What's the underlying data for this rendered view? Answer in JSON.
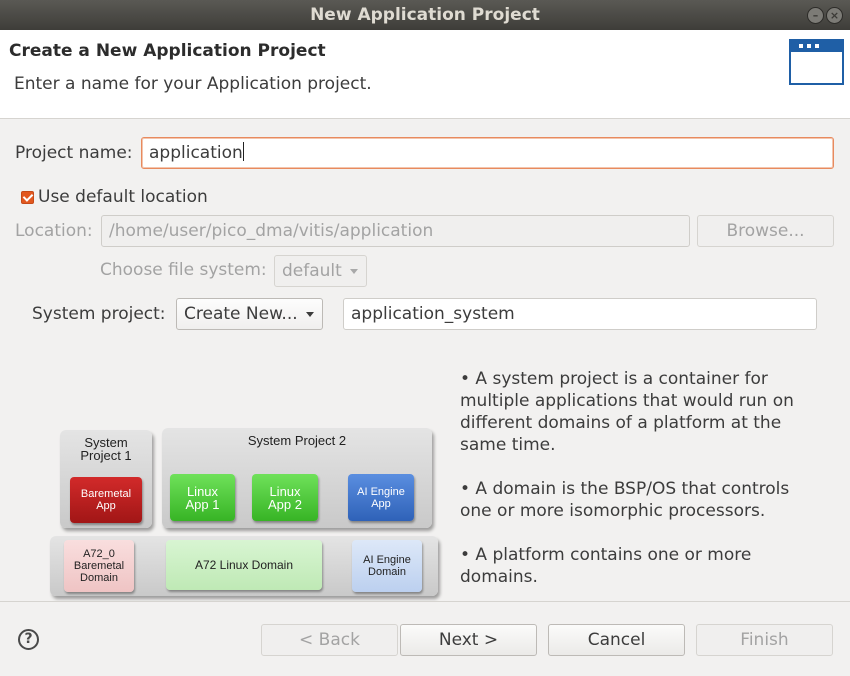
{
  "window": {
    "title": "New Application Project"
  },
  "banner": {
    "title": "Create a New Application Project",
    "description": "Enter a name for your Application project."
  },
  "form": {
    "project_name_label": "Project name:",
    "project_name_value": "application",
    "use_default_location_label": "Use default location",
    "use_default_location_checked": true,
    "location_label": "Location:",
    "location_value": "/home/user/pico_dma/vitis/application",
    "browse_label": "Browse...",
    "file_system_label": "Choose file system:",
    "file_system_value": "default",
    "system_project_label": "System project:",
    "system_project_option": "Create New...",
    "system_project_name": "application_system"
  },
  "info": [
    "• A system project is a container for multiple applications that would run on different domains of a platform at the same time.",
    "• A domain is the BSP/OS that controls one or more isomorphic processors.",
    "• A platform contains one or more domains."
  ],
  "diagram": {
    "system_project_1": "System Project 1",
    "system_project_2": "System Project 2",
    "baremetal_app": "Baremetal App",
    "linux_app_1": "Linux App 1",
    "linux_app_2": "Linux App 2",
    "ai_engine_app": "AI Engine App",
    "a72_0_domain": "A72_0 Baremetal Domain",
    "a72_linux_domain": "A72 Linux Domain",
    "ai_engine_domain": "AI Engine Domain"
  },
  "footer": {
    "help_icon": "?",
    "back_label": "< Back",
    "next_label": "Next >",
    "cancel_label": "Cancel",
    "finish_label": "Finish"
  },
  "colors": {
    "accent": "#e2581f",
    "focus_border": "#e88a5e",
    "banner_icon": "#1f5fa6"
  }
}
